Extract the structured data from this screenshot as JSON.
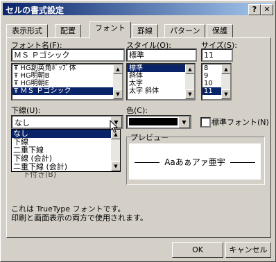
{
  "window": {
    "title": "セルの書式設定",
    "help_label": "?",
    "close_label": "✕"
  },
  "tabs": [
    {
      "label": "表示形式"
    },
    {
      "label": "配置"
    },
    {
      "label": "フォント"
    },
    {
      "label": "罫線"
    },
    {
      "label": "パターン"
    },
    {
      "label": "保護"
    }
  ],
  "font": {
    "label": "フォント名(F):",
    "value": "ＭＳ Ｐゴシック",
    "items": [
      "HG創英角ﾎﾟｯﾌﾟ体",
      "HG明朝B",
      "HG明朝E",
      "ＭＳ Ｐゴシック"
    ]
  },
  "style": {
    "label": "スタイル(O):",
    "value": "標準",
    "items": [
      "標準",
      "斜体",
      "太字",
      "太字 斜体"
    ]
  },
  "size": {
    "label": "サイズ(S):",
    "value": "11",
    "items": [
      "8",
      "9",
      "10",
      "11"
    ]
  },
  "underline": {
    "label": "下線(U):",
    "value": "なし",
    "options": [
      "なし",
      "下線",
      "二重下線",
      "下線 (会計)",
      "二重下線 (会計)"
    ]
  },
  "color": {
    "label": "色(C):",
    "swatch": "#000000"
  },
  "standard_font": {
    "label": "標準フォント(N)"
  },
  "effects": {
    "label_partial": "下付き(B)"
  },
  "preview": {
    "label": "プレビュー",
    "text": "Aaあぁアァ亜宇"
  },
  "info": {
    "line1": "これは TrueType フォントです。",
    "line2": "印刷と画面表示の両方で使用されます。"
  },
  "buttons": {
    "ok": "OK",
    "cancel": "キャンセル"
  },
  "icons": {
    "truetype": "truetype-icon"
  }
}
